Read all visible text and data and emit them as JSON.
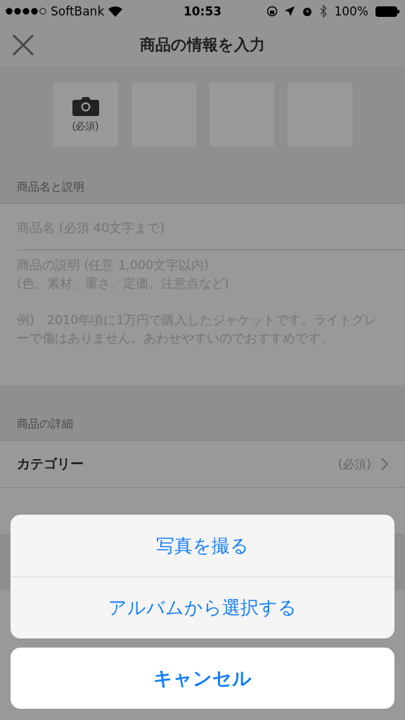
{
  "status_bar": {
    "carrier": "SoftBank",
    "time": "10:53",
    "battery": "100%"
  },
  "nav": {
    "title": "商品の情報を入力"
  },
  "photos": [
    {
      "kind": "add",
      "label": "(必須)"
    },
    {
      "kind": "empty"
    },
    {
      "kind": "empty"
    },
    {
      "kind": "empty"
    }
  ],
  "name_section": {
    "header": "商品名と説明",
    "name_field": {
      "placeholder": "商品名 (必須 40文字まで)"
    },
    "description_field": {
      "placeholder": "商品の説明 (任意 1,000文字以内)\n(色、素材、重さ、定価、注意点など)\n\n例)　2010年頃に1万円で購入したジャケットです。ライトグレーで傷はありません。あわせやすいのでおすすめです。"
    }
  },
  "details": {
    "header": "商品の詳細",
    "rows": [
      {
        "label": "カテゴリー",
        "value": "(必須)"
      }
    ]
  },
  "action_sheet": {
    "options": [
      "写真を撮る",
      "アルバムから選択する"
    ],
    "cancel": "キャンセル"
  }
}
